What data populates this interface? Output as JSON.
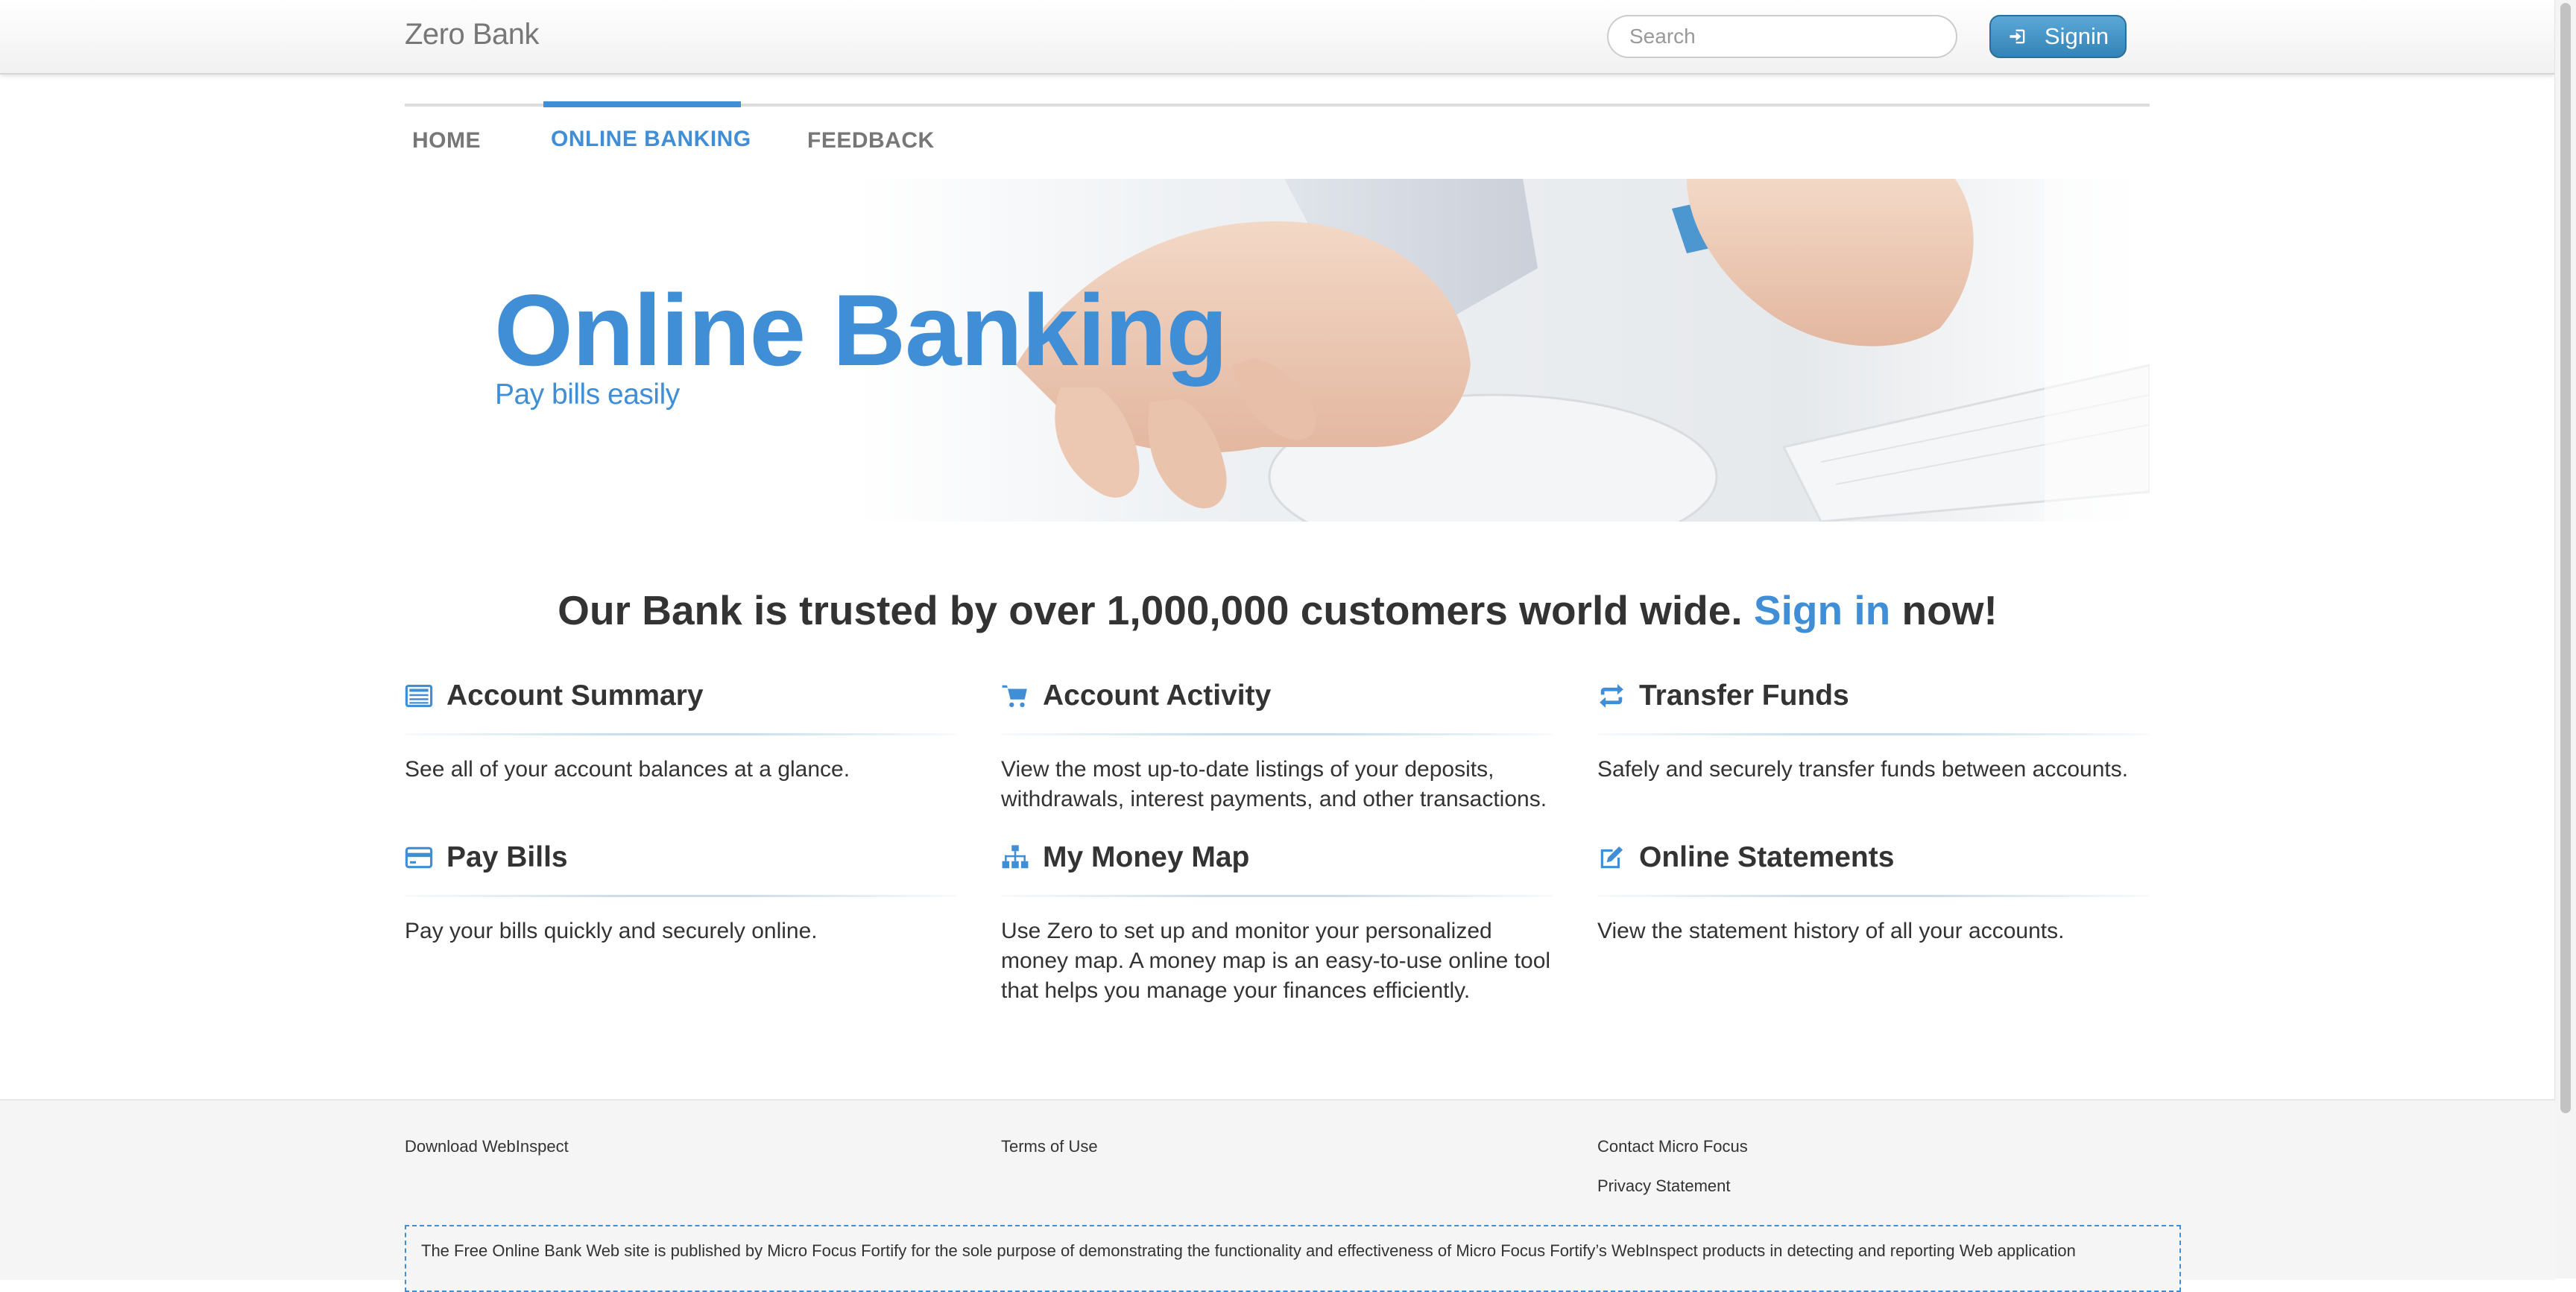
{
  "navbar": {
    "brand": "Zero Bank",
    "search_placeholder": "Search",
    "signin_label": "Signin"
  },
  "tabs": [
    {
      "label": "HOME",
      "active": false
    },
    {
      "label": "ONLINE BANKING",
      "active": true
    },
    {
      "label": "FEEDBACK",
      "active": false
    }
  ],
  "hero": {
    "title": "Online Banking",
    "subtitle": "Pay bills easily"
  },
  "tagline": {
    "before": "Our Bank is trusted by over 1,000,000 customers world wide.",
    "link": "Sign in",
    "after": "now!"
  },
  "features": [
    {
      "icon": "list-icon",
      "title": "Account Summary",
      "text": "See all of your account balances at a glance."
    },
    {
      "icon": "cart-icon",
      "title": "Account Activity",
      "text": "View the most up-to-date listings of your deposits, withdrawals, interest payments, and other transactions."
    },
    {
      "icon": "transfer-icon",
      "title": "Transfer Funds",
      "text": "Safely and securely transfer funds between accounts."
    },
    {
      "icon": "credit-card-icon",
      "title": "Pay Bills",
      "text": "Pay your bills quickly and securely online."
    },
    {
      "icon": "sitemap-icon",
      "title": "My Money Map",
      "text": "Use Zero to set up and monitor your personalized money map. A money map is an easy-to-use online tool that helps you manage your finances efficiently."
    },
    {
      "icon": "edit-icon",
      "title": "Online Statements",
      "text": "View the statement history of all your accounts."
    }
  ],
  "footer": {
    "download": "Download WebInspect",
    "terms": "Terms of Use",
    "contact": "Contact Micro Focus",
    "privacy": "Privacy Statement",
    "disclaimer": "The Free Online Bank Web site is published by Micro Focus Fortify for the sole purpose of demonstrating the functionality and effectiveness of Micro Focus Fortify’s WebInspect products in detecting and reporting Web application"
  },
  "colors": {
    "accent": "#3f8ed6",
    "text": "#333333",
    "muted": "#777777",
    "footer_bg": "#f5f5f5"
  }
}
